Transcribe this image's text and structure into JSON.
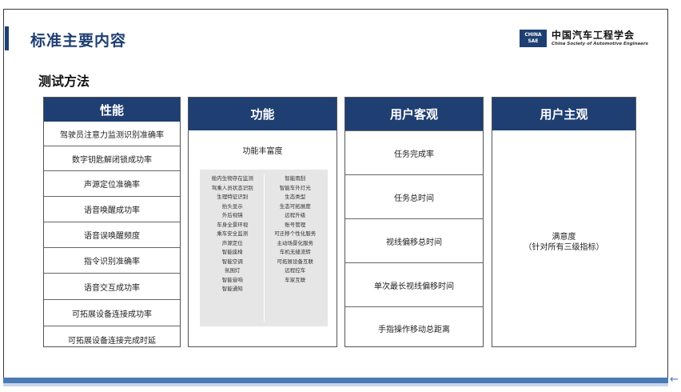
{
  "header": {
    "title": "标准主要内容",
    "logo": {
      "badge_top": "CHINA",
      "badge_bottom": "SAE",
      "name_cn": "中国汽车工程学会",
      "name_en": "China Society of Automotive Engineers"
    }
  },
  "section_title": "测试方法",
  "columns": {
    "performance": {
      "heading": "性能",
      "items": [
        "驾驶员注意力监测识别准确率",
        "数字钥匙解闭锁成功率",
        "声源定位准确率",
        "语音唤醒成功率",
        "语音误唤醒频度",
        "指令识别准确率",
        "语音交互成功率",
        "可拓展设备连接成功率",
        "可拓展设备连接完成时延"
      ]
    },
    "function": {
      "heading": "功能",
      "label": "功能丰富度",
      "left_items": [
        "舱内生物存在监测",
        "驾乘人员状态识别",
        "生理特征识别",
        "抬头显示",
        "外后视镜",
        "车身全景环视",
        "乘车安全监测",
        "声源定位",
        "智能座椅",
        "智能空调",
        "氛围灯",
        "智能音响",
        "智能通知"
      ],
      "right_items": [
        "智能雨刮",
        "智能车外灯光",
        "生态类型",
        "生态可拓展度",
        "远程升级",
        "账号管理",
        "可迁移个性化服务",
        "主动场景化服务",
        "车机无缝流转",
        "可拓展设备互联",
        "远程控车",
        "车家互联"
      ]
    },
    "objective": {
      "heading": "用户客观",
      "items": [
        "任务完成率",
        "任务总时间",
        "视线偏移总时间",
        "单次最长视线偏移时间",
        "手指操作移动总距离"
      ]
    },
    "subjective": {
      "heading": "用户主观",
      "line1": "满意度",
      "line2": "（针对所有三级指标）"
    }
  }
}
